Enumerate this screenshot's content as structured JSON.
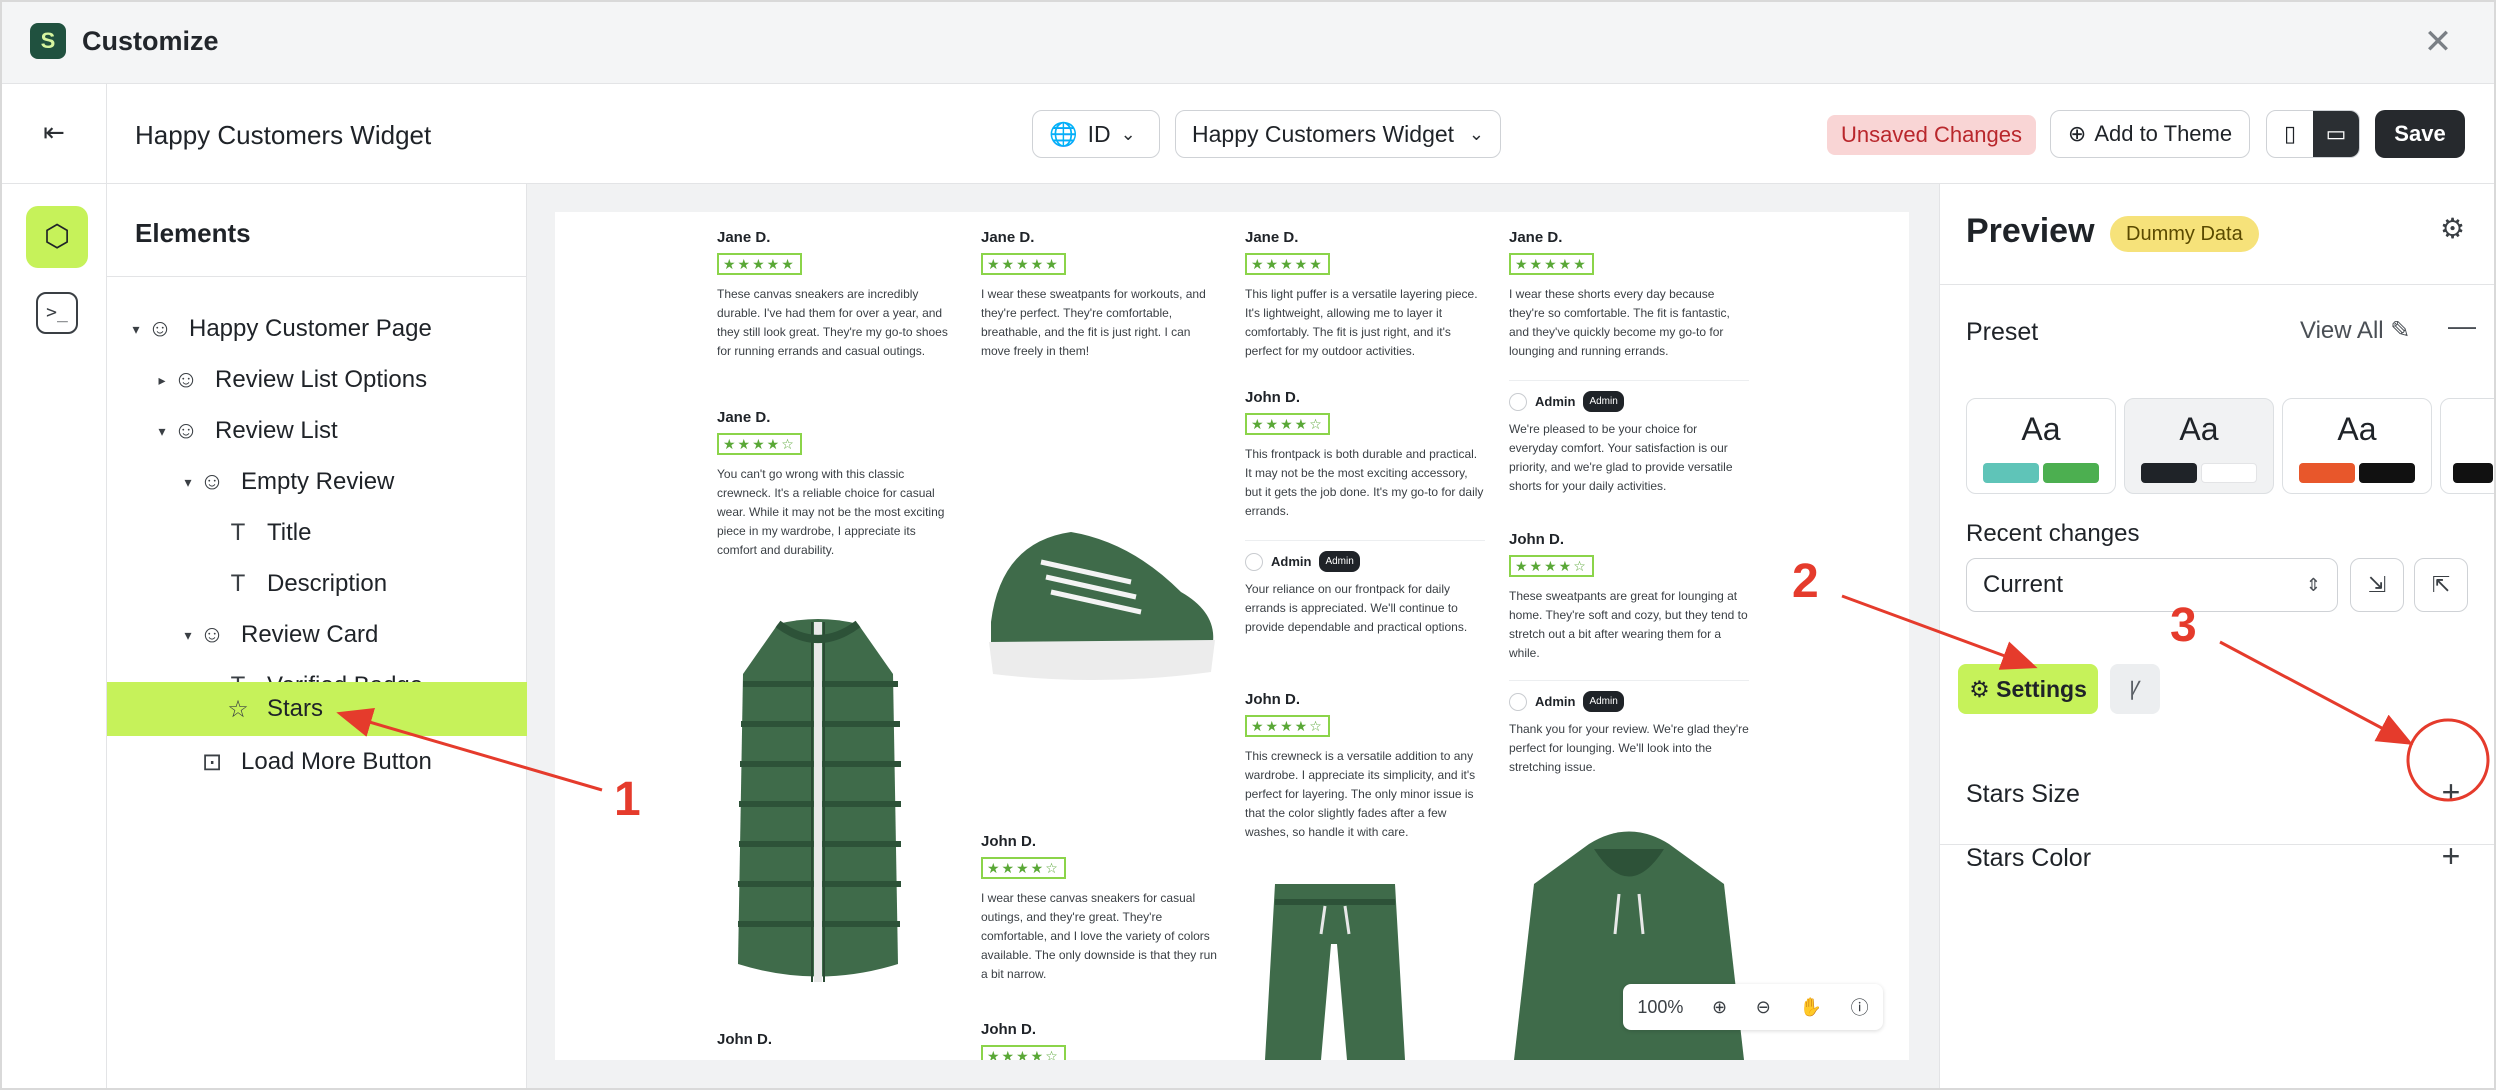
{
  "window": {
    "title": "Customize",
    "logo": "S"
  },
  "toolbar": {
    "page_name": "Happy Customers Widget",
    "language": "ID",
    "widget_select": "Happy Customers Widget",
    "unsaved": "Unsaved Changes",
    "add_to_theme": "Add to Theme",
    "save": "Save"
  },
  "elements": {
    "title": "Elements",
    "items": [
      {
        "label": "Happy Customer Page"
      },
      {
        "label": "Review List Options"
      },
      {
        "label": "Review List"
      },
      {
        "label": "Empty Review"
      },
      {
        "label": "Title"
      },
      {
        "label": "Description"
      },
      {
        "label": "Review Card"
      },
      {
        "label": "Verified Badge"
      },
      {
        "label": "Stars"
      },
      {
        "label": "Load More Button"
      }
    ]
  },
  "canvas": {
    "zoom": "100%",
    "stars_full": "★★★★★",
    "stars_four": "★★★★☆",
    "reviews": [
      {
        "name": "Jane D.",
        "text": "These canvas sneakers are incredibly durable. I've had them for over a year, and they still look great. They're my go-to shoes for running errands and casual outings."
      },
      {
        "name": "Jane D.",
        "text": "You can't go wrong with this classic crewneck. It's a reliable choice for casual wear. While it may not be the most exciting piece in my wardrobe, I appreciate its comfort and durability."
      },
      {
        "name": "John D.",
        "text": ""
      },
      {
        "name": "Jane D.",
        "text": "I wear these sweatpants for workouts, and they're perfect. They're comfortable, breathable, and the fit is just right. I can move freely in them!"
      },
      {
        "name": "John D.",
        "text": "I wear these canvas sneakers for casual outings, and they're great. They're comfortable, and I love the variety of colors available. The only downside is that they run a bit narrow."
      },
      {
        "name": "John D.",
        "text": ""
      },
      {
        "name": "Jane D.",
        "text": "This light puffer is a versatile layering piece. It's lightweight, allowing me to layer it comfortably. The fit is just right, and it's perfect for my outdoor activities."
      },
      {
        "name": "John D.",
        "text": "This frontpack is both durable and practical. It may not be the most exciting accessory, but it gets the job done. It's my go-to for daily errands."
      },
      {
        "name": "John D.",
        "text": "This crewneck is a versatile addition to any wardrobe. I appreciate its simplicity, and it's perfect for layering. The only minor issue is that the color slightly fades after a few washes, so handle it with care."
      },
      {
        "name": "Jane D.",
        "text": "I wear these shorts every day because they're so comfortable. The fit is fantastic, and they've quickly become my go-to for lounging and running errands."
      },
      {
        "name": "John D.",
        "text": "These sweatpants are great for lounging at home. They're soft and cozy, but they tend to stretch out a bit after wearing them for a while."
      }
    ],
    "replies": [
      {
        "name": "Admin",
        "tag": "Admin",
        "text": "Your reliance on our frontpack for daily errands is appreciated. We'll continue to provide dependable and practical options."
      },
      {
        "name": "Admin",
        "tag": "Admin",
        "text": "We're pleased to be your choice for everyday comfort. Your satisfaction is our priority, and we're glad to provide versatile shorts for your daily activities."
      },
      {
        "name": "Admin",
        "tag": "Admin",
        "text": "Thank you for your review. We're glad they're perfect for lounging. We'll look into the stretching issue."
      }
    ]
  },
  "right_panel": {
    "title": "Preview",
    "badge": "Dummy Data",
    "preset_label": "Preset",
    "view_all": "View All",
    "preset_aa": "Aa",
    "recent_label": "Recent changes",
    "recent_value": "Current",
    "settings_tab": "Settings",
    "settings": [
      {
        "label": "Stars Size"
      },
      {
        "label": "Stars Color"
      }
    ]
  },
  "annotations": [
    "1",
    "2",
    "3"
  ],
  "colors": {
    "accent": "#c6f25a",
    "annotation": "#e53b2c",
    "star": "#5aa837",
    "unsaved_bg": "#f9d5d5"
  }
}
